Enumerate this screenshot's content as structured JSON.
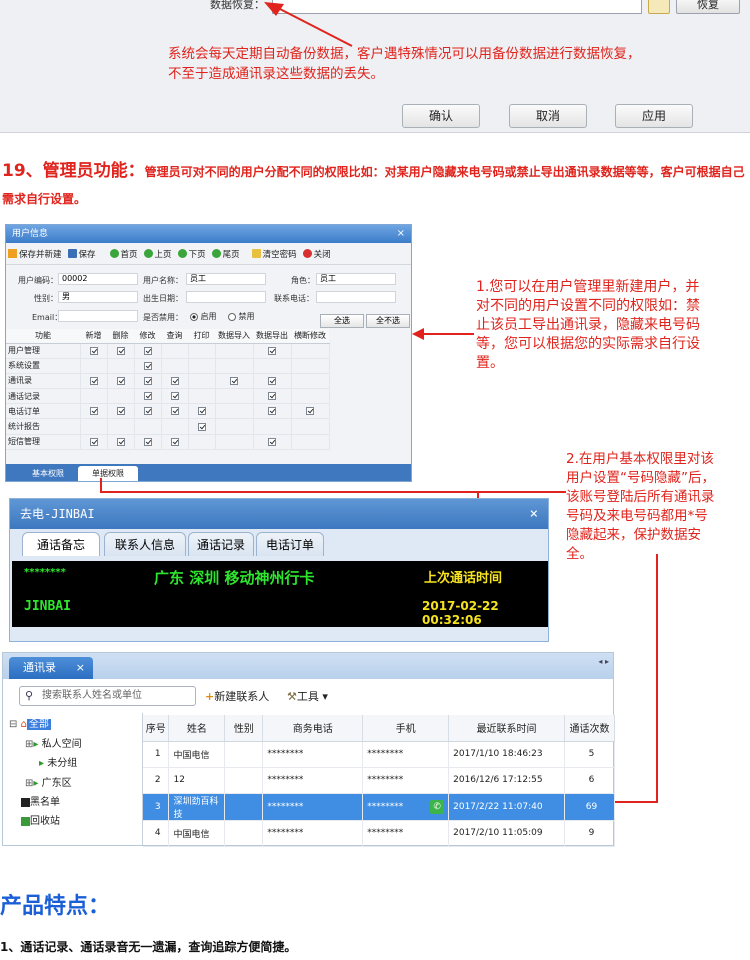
{
  "backup_panel": {
    "restore_label": "数据恢复：",
    "restore_button": "恢复",
    "note": [
      "系统会每天定期自动备份数据，客户遇特殊情况可以用备份数据进行数据恢复，",
      "不至于造成通讯录这些数据的丢失。"
    ],
    "buttons": [
      "确认",
      "取消",
      "应用"
    ]
  },
  "section19": {
    "title": "19、管理员功能：",
    "desc": "管理员可对不同的用户分配不同的权限比如：对某用户隐藏来电号码或禁止导出通讯录数据等等，客户可根据自己需求自行设置。"
  },
  "user_window": {
    "title": "用户信息",
    "toolbar": [
      "保存并新建",
      "保存",
      "首页",
      "上页",
      "下页",
      "尾页",
      "清空密码",
      "关闭"
    ],
    "fields": {
      "code_label": "用户编码：",
      "code_value": "00002",
      "name_label": "用户名称：",
      "name_value": "员工",
      "role_label": "角色：",
      "role_value": "员工",
      "gender_label": "性别：",
      "gender_value": "男",
      "birth_label": "出生日期：",
      "phone_label": "联系电话：",
      "email_label": "Email：",
      "disabled_label": "是否禁用：",
      "enable_option": "启用",
      "disable_option": "禁用"
    },
    "select_all": "全选",
    "select_none": "全不选",
    "columns": [
      "功能",
      "新增",
      "删除",
      "修改",
      "查询",
      "打印",
      "数据导入",
      "数据导出",
      "横断修改"
    ],
    "rows": [
      {
        "name": "用户管理",
        "checks": [
          1,
          1,
          1,
          0,
          0,
          0,
          1,
          0
        ]
      },
      {
        "name": "系统设置",
        "checks": [
          0,
          0,
          1,
          0,
          0,
          0,
          0,
          0
        ]
      },
      {
        "name": "通讯录",
        "checks": [
          1,
          1,
          1,
          1,
          0,
          1,
          1,
          0
        ]
      },
      {
        "name": "通话记录",
        "checks": [
          0,
          0,
          1,
          1,
          0,
          0,
          1,
          0
        ]
      },
      {
        "name": "电话订单",
        "checks": [
          1,
          1,
          1,
          1,
          1,
          0,
          1,
          1
        ]
      },
      {
        "name": "统计报告",
        "checks": [
          0,
          0,
          0,
          0,
          1,
          0,
          0,
          0
        ]
      },
      {
        "name": "短信管理",
        "checks": [
          1,
          1,
          1,
          1,
          0,
          0,
          1,
          0
        ]
      }
    ],
    "bottom_tabs": [
      "基本权限",
      "单据权限"
    ]
  },
  "annotation1": [
    "1.您可以在用户管理里新建用户，并",
    "对不同的用户设置不同的权限如：禁",
    "止该员工导出通讯录，隐藏来电号码",
    "等，您可以根据您的实际需求自行设",
    "置。"
  ],
  "annotation2": [
    "2.在用户基本权限里对该",
    "用户设置“号码隐藏”后，",
    "该账号登陆后所有通讯录",
    "号码及来电号码都用*号",
    "隐藏起来，保护数据安",
    "全。"
  ],
  "call_window": {
    "title": "去电-JINBAI",
    "tabs": [
      "通话备忘",
      "联系人信息",
      "通话记录",
      "电话订单"
    ],
    "masked_number": "********",
    "location": "广东 深圳 移动神州行卡",
    "last_call_label": "上次通话时间",
    "contact_name": "JINBAI",
    "last_call_time": "2017-02-22 00:32:06"
  },
  "contacts_window": {
    "tab": "通讯录",
    "search_placeholder": "搜索联系人姓名或单位",
    "new_contact": "新建联系人",
    "tools": "工具",
    "tree": [
      "全部",
      "私人空间",
      "未分组",
      "广东区",
      "黑名单",
      "回收站"
    ],
    "columns": [
      "序号",
      "姓名",
      "性别",
      "商务电话",
      "手机",
      "最近联系时间",
      "通话次数"
    ],
    "rows": [
      {
        "no": "1",
        "name": "中国电信",
        "gender": "",
        "biz": "********",
        "mobile": "********",
        "time": "2017/1/10 18:46:23",
        "count": "5"
      },
      {
        "no": "2",
        "name": "12",
        "gender": "",
        "biz": "********",
        "mobile": "********",
        "time": "2016/12/6 17:12:55",
        "count": "6"
      },
      {
        "no": "3",
        "name": "深圳劲百科技",
        "gender": "",
        "biz": "********",
        "mobile": "********",
        "time": "2017/2/22 11:07:40",
        "count": "69"
      },
      {
        "no": "4",
        "name": "中国电信",
        "gender": "",
        "biz": "********",
        "mobile": "********",
        "time": "2017/2/10 11:05:09",
        "count": "9"
      }
    ]
  },
  "features": {
    "title": "产品特点：",
    "item1": "1、通话记录、通话录音无一遗漏，查询追踪方便简捷。"
  }
}
